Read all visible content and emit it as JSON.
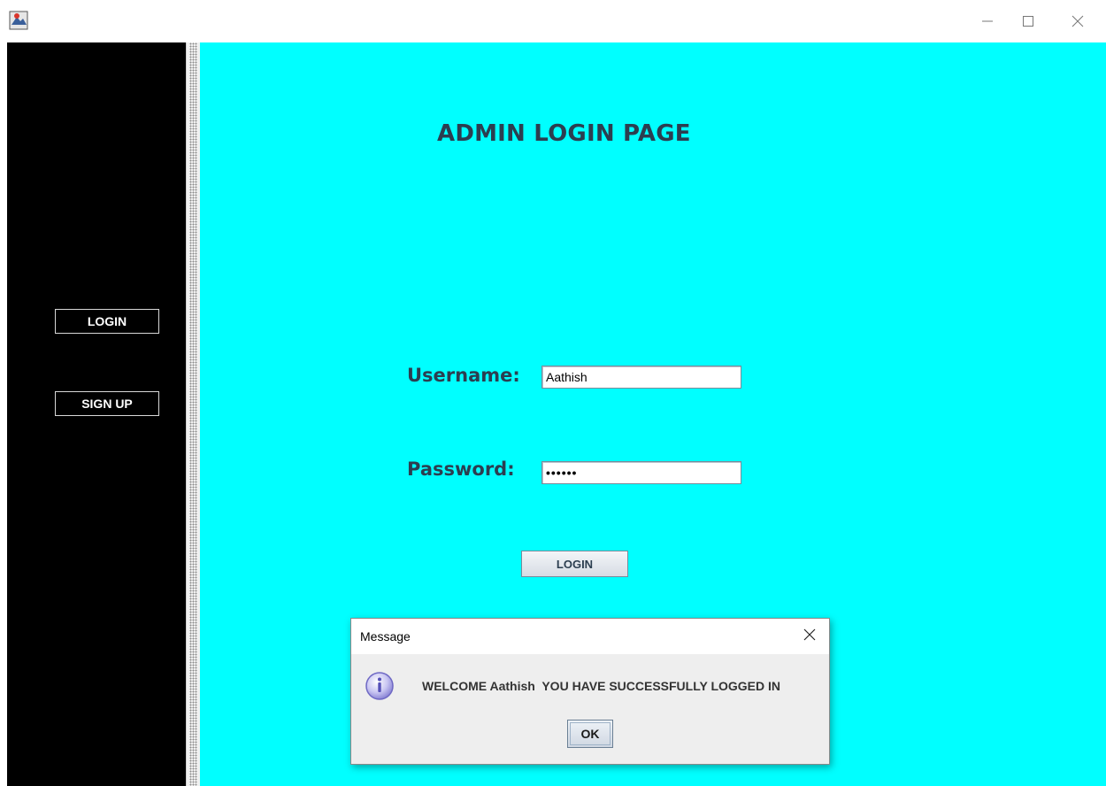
{
  "window": {
    "icon": "java-app-icon",
    "controls": [
      "minimize-icon",
      "maximize-icon",
      "close-icon"
    ]
  },
  "sidebar": {
    "buttons": [
      {
        "label": "LOGIN"
      },
      {
        "label": "SIGN UP"
      }
    ]
  },
  "main": {
    "title": "ADMIN LOGIN PAGE",
    "username_label": "Username:",
    "username_value": "Aathish",
    "password_label": "Password:",
    "password_value": "••••••",
    "login_button": "LOGIN",
    "background": "#00ffff"
  },
  "dialog": {
    "title": "Message",
    "icon": "info-icon",
    "message": "WELCOME Aathish  YOU HAVE SUCCESSFULLY LOGGED IN",
    "ok_button": "OK"
  }
}
